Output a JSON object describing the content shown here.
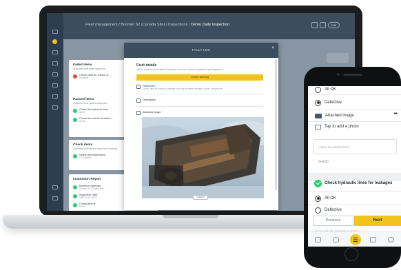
{
  "laptop": {
    "breadcrumb_path": "Fleet management / Boomer S2 (Canada Site) / Inspections / ",
    "breadcrumb_current": "Demo Daily Inspection",
    "topbar_button": "Edit",
    "cards": {
      "failed": {
        "title": "Failed items",
        "subtitle": "Outcomes that failed inspection",
        "row1": "Check paint for cracks or...",
        "row1_sub": "Defective"
      },
      "passed": {
        "title": "Passed items",
        "subtitle": "Outcomes that passed inspection",
        "row1": "Check the hydraulic lines...",
        "row1_sub": "All OK",
        "row2": "Check the overall condition...",
        "row2_sub": "All OK"
      },
      "check": {
        "title": "Check items",
        "subtitle": "Summary of items that have been checked",
        "row1": "Safety and inspections",
        "row1_sub": "12 Checked"
      },
      "report": {
        "title": "Inspection Report",
        "machine_label": "Machine inspected",
        "machine_value": "Boomer S2 (Canada Site)",
        "date_label": "Inspection Date",
        "date_value": "2020-09-25 09:34",
        "by_label": "Conducted by",
        "by_value": "Demo"
      }
    },
    "modal": {
      "title": "FAULT LOG",
      "close": "×",
      "fault_title": "Fault details",
      "fault_sub": "Here's what we know about the issue. You can create or update a fault log below.",
      "create_btn": "Create fault log",
      "failed_item": "Failed item",
      "failed_item_sub": "Check paint for cracks or damage that may increase damage to other components",
      "description_label": "Description",
      "attached_label": "Attached image",
      "cancel_btn": "Cancel"
    }
  },
  "phone": {
    "option_top": "All OK",
    "option_defective": "Defective",
    "attached_image": "Attached image",
    "menu_dots": "•••",
    "add_photo": "Tap to add a photo",
    "desc_placeholder": "Add a description here.",
    "char_count": "0/4000",
    "check_title": "Check hydraulic lines for leakages",
    "option_ok": "All OK",
    "option_defective2": "Defective",
    "btn_previous": "Previous",
    "btn_next": "Next",
    "ghost_text": "Do you see any hydraulic oil attach..."
  },
  "colors": {
    "accent_yellow": "#f2c31b",
    "ok_green": "#2ecc71",
    "fail_red": "#e74c3c",
    "navy": "#2c3e50"
  }
}
